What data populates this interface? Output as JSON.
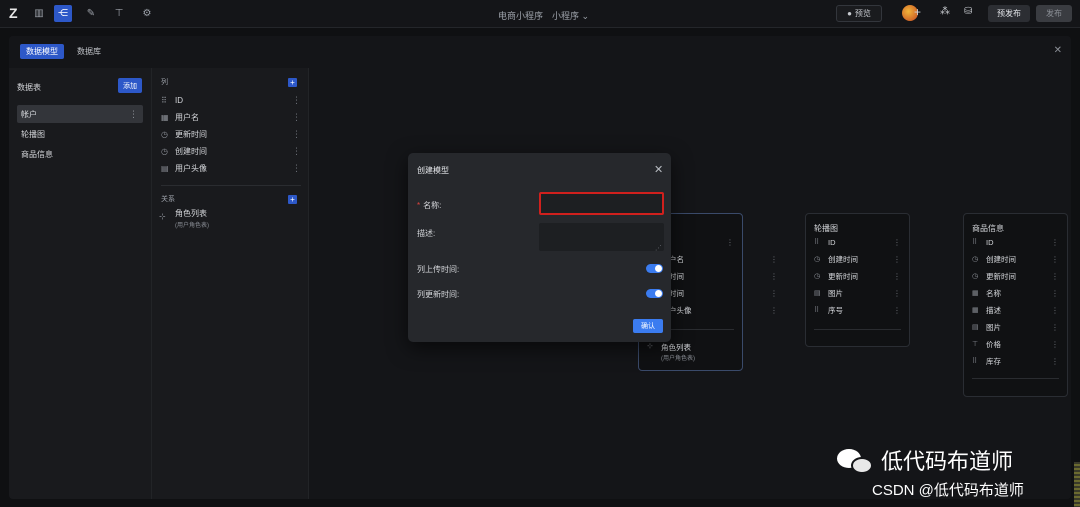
{
  "topbar": {
    "logo": "Z",
    "app_title": "电商小程序",
    "env_select": "小程序",
    "preview_label": "预览",
    "prerelease_label": "预发布",
    "release_label": "发布"
  },
  "panel": {
    "tabs": [
      {
        "label": "数据模型",
        "active": true
      },
      {
        "label": "数据库",
        "active": false
      }
    ]
  },
  "tables_panel": {
    "title": "数据表",
    "add_label": "添加",
    "items": [
      {
        "label": "帐户",
        "selected": true
      },
      {
        "label": "轮播图",
        "selected": false
      },
      {
        "label": "商品信息",
        "selected": false
      }
    ]
  },
  "fields_panel": {
    "columns_label": "列",
    "fields": [
      {
        "icon": "⠿",
        "label": "ID"
      },
      {
        "icon": "▦",
        "label": "用户名"
      },
      {
        "icon": "◷",
        "label": "更新时间"
      },
      {
        "icon": "◷",
        "label": "创建时间"
      },
      {
        "icon": "▤",
        "label": "用户头像"
      }
    ],
    "relations_label": "关系",
    "relations": [
      {
        "label": "角色列表",
        "sub": "(用户角色表)"
      }
    ]
  },
  "canvas": {
    "account_card": {
      "fields": [
        "户名",
        "时间",
        "时间",
        "户头像"
      ],
      "relation": {
        "label": "角色列表",
        "sub": "(用户角色表)"
      }
    },
    "carousel_card": {
      "title": "轮播图",
      "fields": [
        "ID",
        "创建时间",
        "更新时间",
        "图片",
        "序号"
      ]
    },
    "product_card": {
      "title": "商品信息",
      "fields": [
        "ID",
        "创建时间",
        "更新时间",
        "名称",
        "描述",
        "图片",
        "价格",
        "库存"
      ]
    }
  },
  "modal": {
    "title": "创建模型",
    "name_label": "名称:",
    "name_value": "",
    "desc_label": "描述:",
    "desc_value": "",
    "col_created_label": "列上传时间:",
    "col_created_enabled": true,
    "col_updated_label": "列更新时间:",
    "col_updated_enabled": true,
    "confirm_label": "确认"
  },
  "watermark": {
    "line1": "低代码布道师",
    "line2": "CSDN @低代码布道师"
  },
  "colors": {
    "accent": "#2d58c8",
    "toggle": "#3b7cf0",
    "error": "#d0201d"
  }
}
